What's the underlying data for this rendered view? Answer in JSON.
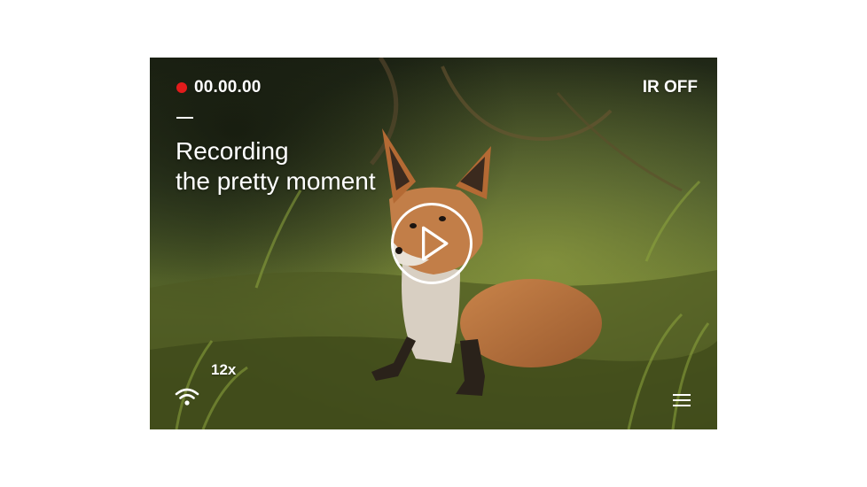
{
  "recording": {
    "indicator_color": "#e21b1b",
    "timecode": "00.00.00"
  },
  "ir_status": "IR OFF",
  "headline": {
    "line1": "Recording",
    "line2": "the pretty moment"
  },
  "zoom_level": "12x",
  "icons": {
    "play": "play-icon",
    "wifi": "wifi-icon",
    "menu": "menu-icon",
    "record": "record-dot-icon"
  }
}
